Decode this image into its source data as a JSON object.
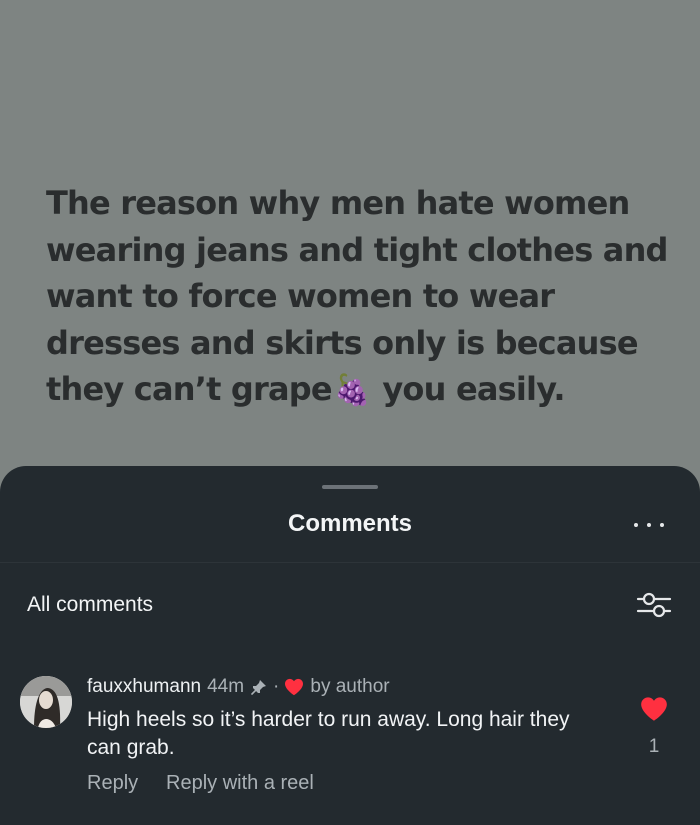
{
  "post": {
    "lines": [
      "The reason why men hate women",
      "wearing jeans and tight clothes and",
      "want to force women to wear",
      "dresses and skirts only is because",
      "they can’t grape"
    ],
    "emoji": "🍇",
    "line5_tail": "you easily."
  },
  "comments_sheet": {
    "title": "Comments",
    "more_icon": "more-horizontal-icon",
    "filter_label": "All comments",
    "filter_icon": "sliders-icon"
  },
  "comments": [
    {
      "username": "fauxxhumann",
      "time": "44m",
      "pinned": true,
      "separator": "·",
      "liked_by_author_label": "by author",
      "text": "High heels so it’s harder to run away. Long hair they can grab.",
      "reply_label": "Reply",
      "reply_reel_label": "Reply with a reel",
      "like_count": "1",
      "liked": true
    }
  ],
  "colors": {
    "post_background": "#7e8482",
    "post_text": "#2a2d2e",
    "sheet_background": "#232a2f",
    "heart_red": "#ff3040",
    "secondary_text": "#aab1b6"
  }
}
